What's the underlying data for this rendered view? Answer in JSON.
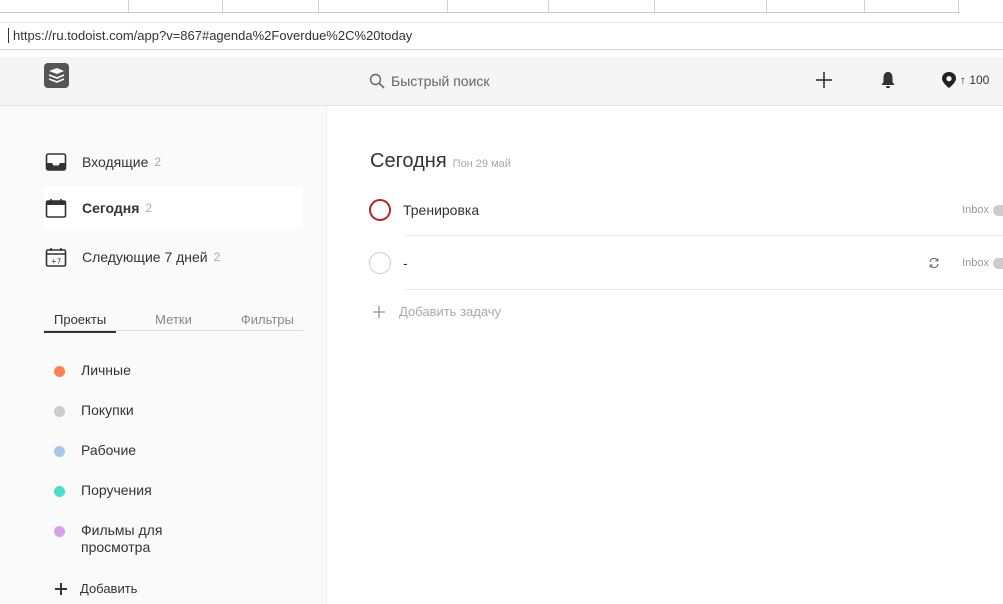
{
  "browser": {
    "url": "https://ru.todoist.com/app?v=867#agenda%2Foverdue%2C%20today"
  },
  "header": {
    "search_placeholder": "Быстрый поиск",
    "karma_text": "↑ 100"
  },
  "sidebar": {
    "nav": [
      {
        "label": "Входящие",
        "count": "2",
        "icon": "inbox-icon"
      },
      {
        "label": "Сегодня",
        "count": "2",
        "icon": "calendar-today-icon"
      },
      {
        "label": "Следующие 7 дней",
        "count": "2",
        "icon": "calendar-next-7-icon"
      }
    ],
    "tabs": [
      "Проекты",
      "Метки",
      "Фильтры"
    ],
    "projects": [
      {
        "label": "Личные",
        "color": "#fc8059"
      },
      {
        "label": "Покупки",
        "color": "#cccccc"
      },
      {
        "label": "Рабочие",
        "color": "#a8c8e8"
      },
      {
        "label": "Поручения",
        "color": "#4fdcc6"
      },
      {
        "label": "Фильмы для просмотра",
        "color": "#d7a1ea"
      }
    ],
    "add_project_label": "Добавить"
  },
  "main": {
    "title": "Сегодня",
    "date": "Пон 29 май",
    "tasks": [
      {
        "text": "Тренировка",
        "project": "Inbox",
        "priority": "p1"
      },
      {
        "text": "-",
        "project": "Inbox",
        "priority": "p4",
        "recurring": true
      }
    ],
    "add_task_label": "Добавить задачу"
  },
  "colors": {
    "priority_1": "#b32428",
    "sidebar_bg": "#fafafa",
    "header_bg": "#f5f5f5"
  }
}
